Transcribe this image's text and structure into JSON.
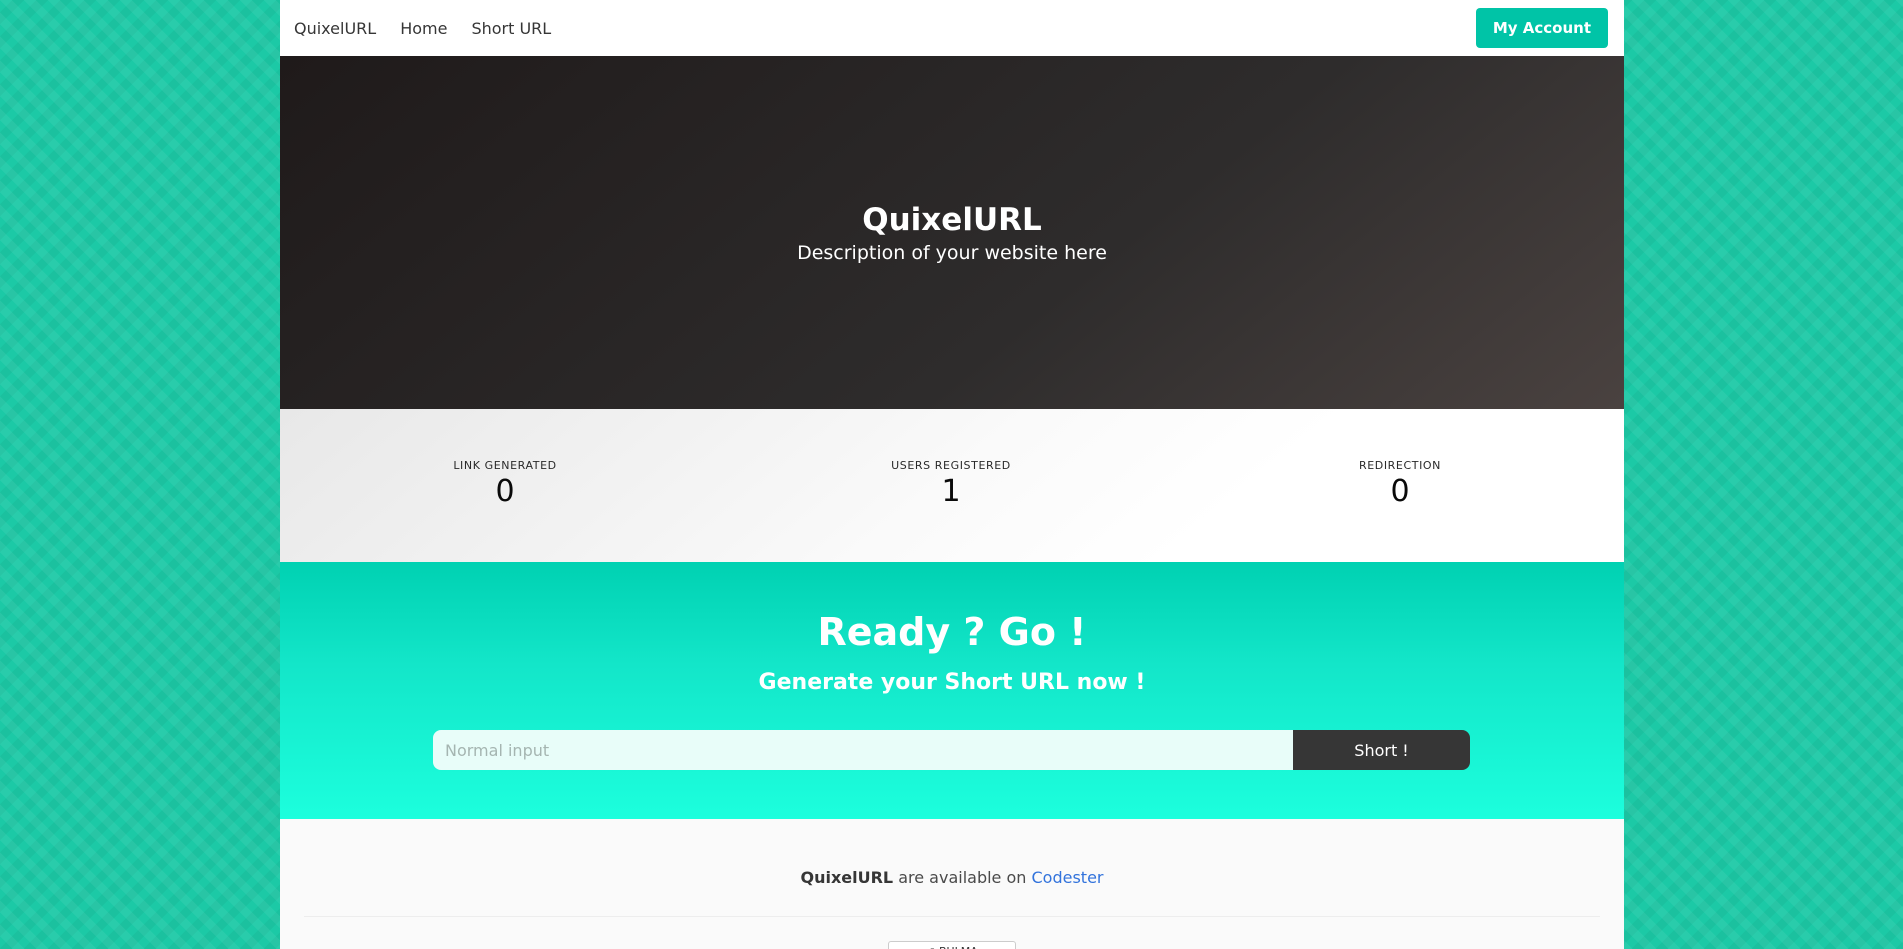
{
  "navbar": {
    "brand": "QuixelURL",
    "links": [
      "Home",
      "Short URL"
    ],
    "account_button": "My Account"
  },
  "hero": {
    "title": "QuixelURL",
    "subtitle": "Description of your website here"
  },
  "stats": [
    {
      "label": "LINK GENERATED",
      "value": "0"
    },
    {
      "label": "USERS REGISTERED",
      "value": "1"
    },
    {
      "label": "REDIRECTION",
      "value": "0"
    }
  ],
  "go": {
    "title": "Ready ? Go !",
    "subtitle": "Generate your Short URL now !",
    "input_placeholder": "Normal input",
    "button": "Short !"
  },
  "footer": {
    "brand": "QuixelURL",
    "text_mid": " are available on ",
    "link": "Codester",
    "badge": "↗ BULMA"
  },
  "colors": {
    "accent": "#00c4a7",
    "background_pattern": "#1cc9a6",
    "dark": "#363636",
    "link": "#3273dc"
  }
}
